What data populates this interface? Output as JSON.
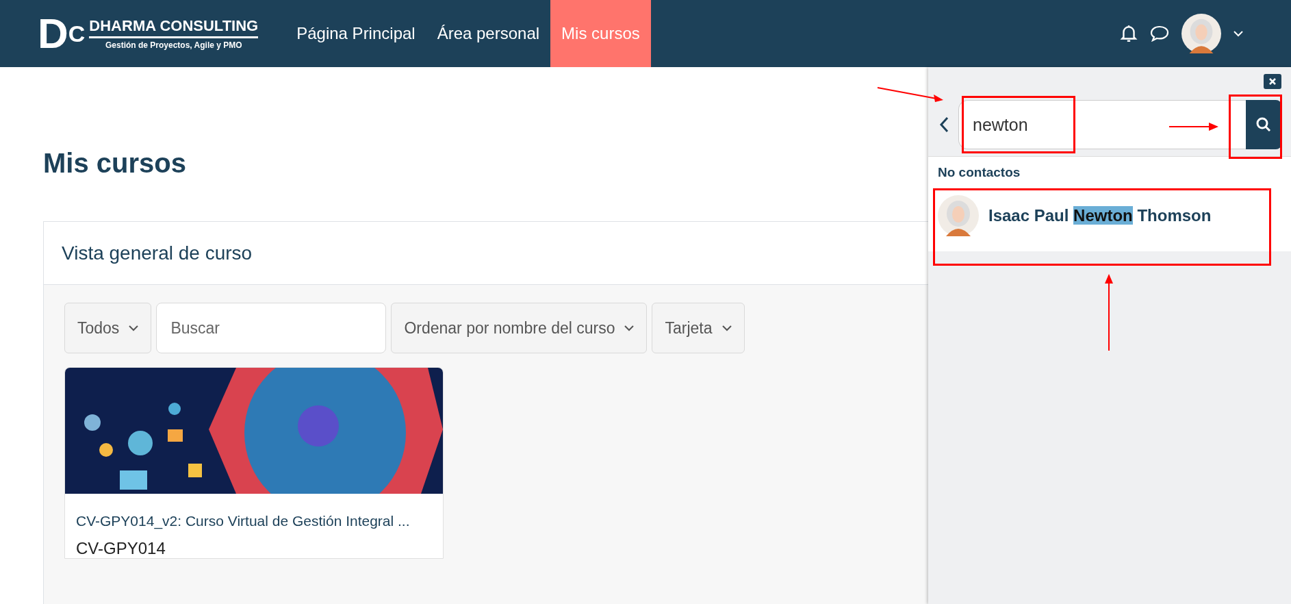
{
  "brand": {
    "logo_letters": [
      "D",
      "C"
    ],
    "name": "DHARMA CONSULTING",
    "tagline": "Gestión de Proyectos, Agile y PMO"
  },
  "nav": [
    {
      "label": "Página Principal",
      "selected": false
    },
    {
      "label": "Área personal",
      "selected": false
    },
    {
      "label": "Mis cursos",
      "selected": true
    }
  ],
  "page_title": "Mis cursos",
  "overview": {
    "title": "Vista general de curso",
    "filters": [
      {
        "kind": "dropdown",
        "label": "Todos"
      },
      {
        "kind": "search",
        "placeholder": "Buscar"
      },
      {
        "kind": "dropdown",
        "label": "Ordenar por nombre del curso"
      },
      {
        "kind": "dropdown",
        "label": "Tarjeta"
      }
    ],
    "courses": [
      {
        "title": "CV-GPY014_v2: Curso Virtual de Gestión Integral ...",
        "code": "CV-GPY014"
      }
    ]
  },
  "drawer": {
    "search": {
      "value": "newton"
    },
    "section_title": "No contactos",
    "results": [
      {
        "name_parts": [
          {
            "text": "Isaac Paul ",
            "highlighted": false
          },
          {
            "text": "Newton",
            "highlighted": true
          },
          {
            "text": " Thomson",
            "highlighted": false
          }
        ]
      }
    ]
  }
}
